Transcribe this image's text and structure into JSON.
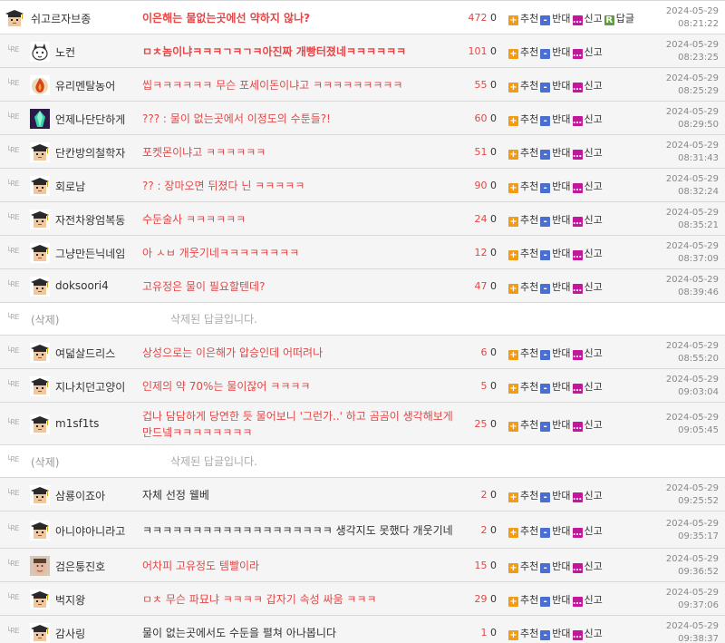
{
  "actions": {
    "up": "추천",
    "down": "반대",
    "report": "신고",
    "reply": "답글"
  },
  "icons": {
    "up": "+",
    "down": "-",
    "report": "…",
    "reply": "R"
  },
  "re_mark": "└RE",
  "rows": [
    {
      "kind": "parent",
      "nick": "쉬고르자브종",
      "avatar": "mortarboard-avatar",
      "content": "이은해는 물없는곳에선 약하지 않나?",
      "content_style": "bold",
      "up": "472",
      "down": "0",
      "reply_btn": true,
      "date": "2024-05-29",
      "time": "08:21:22"
    },
    {
      "kind": "reply",
      "nick": "노컨",
      "avatar": "cat-avatar",
      "content": "ㅁㅊ놈이냐ㅋㅋㅋㄱㅋㄱㅋ아진짜 개빵터졌네ㅋㅋㅋㅋㅋㅋ",
      "content_style": "bold",
      "up": "101",
      "down": "0",
      "date": "2024-05-29",
      "time": "08:23:25"
    },
    {
      "kind": "reply",
      "nick": "유리멘탈농어",
      "avatar": "flame-avatar",
      "content": "씹ㅋㅋㅋㅋㅋㅋ 무슨 포세이돈이냐고 ㅋㅋㅋㅋㅋㅋㅋㅋㅋ",
      "content_style": "red",
      "up": "55",
      "down": "0",
      "date": "2024-05-29",
      "time": "08:25:29"
    },
    {
      "kind": "reply",
      "nick": "언제나단단하게",
      "avatar": "crystal-avatar",
      "content": "??? : 물이 없는곳에서 이정도의 수툰들?!",
      "content_style": "red",
      "up": "60",
      "down": "0",
      "date": "2024-05-29",
      "time": "08:29:50"
    },
    {
      "kind": "reply",
      "nick": "단칸방의철학자",
      "avatar": "mortarboard-avatar",
      "content": "포켓몬이냐고 ㅋㅋㅋㅋㅋㅋ",
      "content_style": "red",
      "up": "51",
      "down": "0",
      "date": "2024-05-29",
      "time": "08:31:43"
    },
    {
      "kind": "reply",
      "nick": "회로남",
      "avatar": "mortarboard-avatar",
      "content": "?? : 장마오면 뒤졌다 닌 ㅋㅋㅋㅋㅋ",
      "content_style": "red",
      "up": "90",
      "down": "0",
      "date": "2024-05-29",
      "time": "08:32:24"
    },
    {
      "kind": "reply",
      "nick": "자전차왕엄복동",
      "avatar": "mortarboard-avatar",
      "content": "수둔술사 ㅋㅋㅋㅋㅋㅋ",
      "content_style": "red",
      "up": "24",
      "down": "0",
      "date": "2024-05-29",
      "time": "08:35:21"
    },
    {
      "kind": "reply",
      "nick": "그냥만든닉네임",
      "avatar": "mortarboard-avatar",
      "content": "아 ㅅㅂ 개웃기네ㅋㅋㅋㅋㅋㅋㅋㅋ",
      "content_style": "red",
      "up": "12",
      "down": "0",
      "date": "2024-05-29",
      "time": "08:37:09"
    },
    {
      "kind": "reply",
      "nick": "doksoori4",
      "avatar": "mortarboard-avatar",
      "content": "고유정은 물이 필요할텐데?",
      "content_style": "red",
      "up": "47",
      "down": "0",
      "date": "2024-05-29",
      "time": "08:39:46"
    },
    {
      "kind": "deleted",
      "nick": "(삭제)",
      "content": "삭제된 답글입니다."
    },
    {
      "kind": "reply",
      "nick": "여덟살드리스",
      "avatar": "mortarboard-avatar",
      "content": "상성으로는 이은해가 압승인데 어떠려나",
      "content_style": "red",
      "up": "6",
      "down": "0",
      "date": "2024-05-29",
      "time": "08:55:20"
    },
    {
      "kind": "reply",
      "nick": "지나치던고양이",
      "avatar": "mortarboard-avatar",
      "content": "인제의 약 70%는 물이잖어 ㅋㅋㅋㅋ",
      "content_style": "red",
      "up": "5",
      "down": "0",
      "date": "2024-05-29",
      "time": "09:03:04"
    },
    {
      "kind": "reply",
      "nick": "m1sf1ts",
      "avatar": "mortarboard-avatar",
      "content": "겁나 담담하게 당연한 듯 물어보니 '그런가..' 하고 곰곰이 생각해보게 만드넼ㅋㅋㅋㅋㅋㅋㅋㅋ",
      "content_style": "red",
      "up": "25",
      "down": "0",
      "date": "2024-05-29",
      "time": "09:05:45"
    },
    {
      "kind": "deleted",
      "nick": "(삭제)",
      "content": "삭제된 답글입니다."
    },
    {
      "kind": "reply",
      "nick": "삼룡이죠아",
      "avatar": "mortarboard-avatar",
      "content": "자체 선정 웰베",
      "content_style": "normal",
      "up": "2",
      "down": "0",
      "date": "2024-05-29",
      "time": "09:25:52"
    },
    {
      "kind": "reply",
      "nick": "아니야아니라고",
      "avatar": "mortarboard-avatar",
      "content": "ㅋㅋㅋㅋㅋㅋㅋㅋㅋㅋㅋㅋㅋㅋㅋㅋㅋㅋㅋ 생각지도 못했다 개웃기네",
      "content_style": "normal",
      "up": "2",
      "down": "0",
      "date": "2024-05-29",
      "time": "09:35:17"
    },
    {
      "kind": "reply",
      "nick": "검은퉁진호",
      "avatar": "face-avatar",
      "content": "어차피 고유정도 템빨이라",
      "content_style": "red",
      "up": "15",
      "down": "0",
      "date": "2024-05-29",
      "time": "09:36:52"
    },
    {
      "kind": "reply",
      "nick": "벅지왕",
      "avatar": "mortarboard-avatar",
      "content": "ㅁㅊ 무슨 파묘냐 ㅋㅋㅋㅋ 갑자기 속성 싸움 ㅋㅋㅋ",
      "content_style": "red",
      "up": "29",
      "down": "0",
      "date": "2024-05-29",
      "time": "09:37:06"
    },
    {
      "kind": "reply",
      "nick": "감사링",
      "avatar": "mortarboard-avatar",
      "content": "물이 없는곳에서도 수둔을 펼쳐 아나봅니다",
      "content_style": "normal",
      "up": "1",
      "down": "0",
      "date": "2024-05-29",
      "time": "09:38:37"
    }
  ]
}
